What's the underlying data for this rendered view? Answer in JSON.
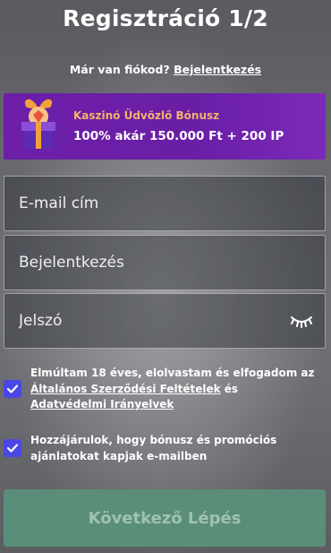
{
  "header": {
    "title": "Regisztráció 1/2"
  },
  "login_prompt": {
    "text": "Már van fiókod?",
    "link": "Bejelentkezés"
  },
  "bonus": {
    "subtitle": "Kaszinó Üdvözlő Bónusz",
    "headline": "100% akár 150.000 Ft + 200 IP",
    "icon": "gift-icon"
  },
  "form": {
    "email_placeholder": "E-mail cím",
    "username_placeholder": "Bejelentkezés",
    "password_placeholder": "Jelszó",
    "password_toggle_icon": "eye-closed-icon"
  },
  "terms": {
    "checked": true,
    "text_before": "Elmúltam 18 éves, elolvastam és elfogadom az",
    "terms_link": "Általános Szerződési Feltételek",
    "conjunction": "és",
    "privacy_link": "Adatvédelmi Irányelvek"
  },
  "marketing": {
    "checked": true,
    "text": "Hozzájárulok, hogy bónusz és promóciós ajánlatokat kapjak e-mailben"
  },
  "submit": {
    "label": "Következő Lépés"
  },
  "colors": {
    "accent": "#4b47e4",
    "bonus_bg": "#6d1fa8",
    "bonus_subtitle": "#f5b26e",
    "button_bg": "#5a8e78"
  }
}
